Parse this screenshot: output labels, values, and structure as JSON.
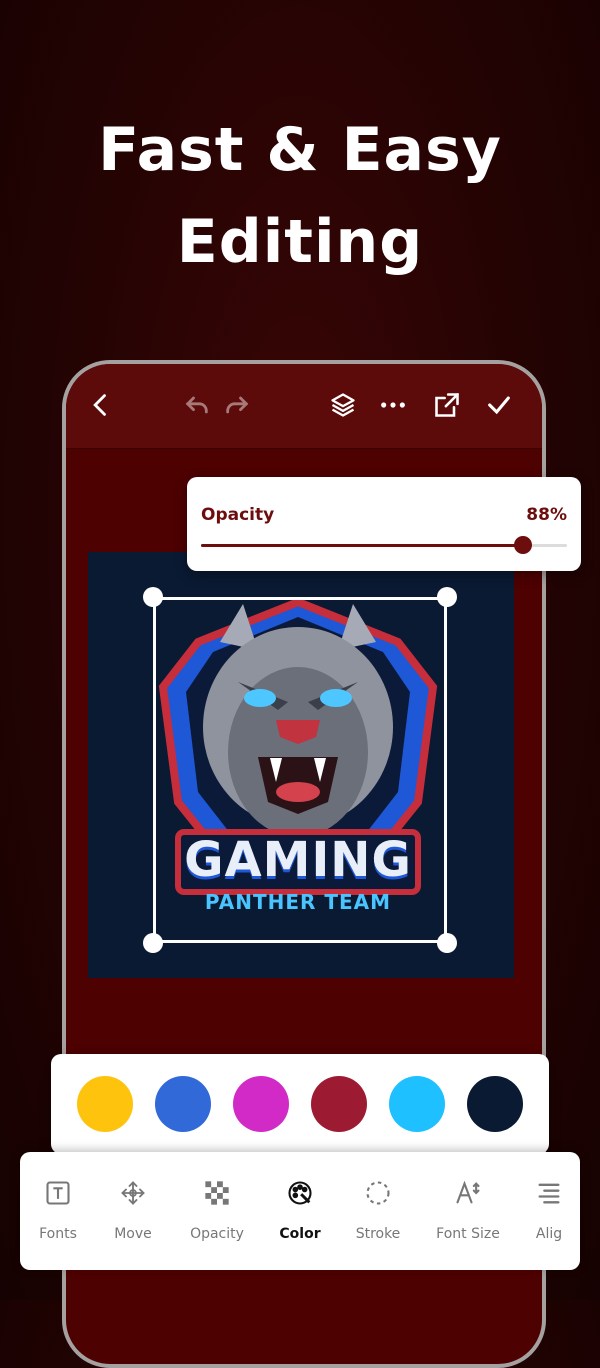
{
  "headline": {
    "line1": "Fast & Easy",
    "line2": "Editing"
  },
  "topbar": {
    "icons": [
      "back-icon",
      "undo-icon",
      "redo-icon",
      "layers-icon",
      "more-icon",
      "export-icon",
      "check-icon"
    ]
  },
  "logo": {
    "title": "GAMING",
    "subtitle": "PANTHER TEAM"
  },
  "opacity_panel": {
    "label": "Opacity",
    "value_text": "88%",
    "value": 0.88
  },
  "swatches": [
    "#fec40d",
    "#3169d9",
    "#d22ac6",
    "#9d1b32",
    "#1ec0ff",
    "#0a1a33"
  ],
  "toolbar": {
    "items": [
      {
        "label": "Fonts",
        "icon": "text-box-icon"
      },
      {
        "label": "Move",
        "icon": "move-icon"
      },
      {
        "label": "Opacity",
        "icon": "checkerboard-icon"
      },
      {
        "label": "Color",
        "icon": "color-palette-icon"
      },
      {
        "label": "Stroke",
        "icon": "dashed-circle-icon"
      },
      {
        "label": "Font Size",
        "icon": "font-size-icon"
      },
      {
        "label": "Alig",
        "icon": "align-icon"
      }
    ],
    "active": "Color"
  },
  "colors": {
    "accent": "#6d0d0d",
    "background": "#240303",
    "phone_screen": "#4d0101"
  }
}
